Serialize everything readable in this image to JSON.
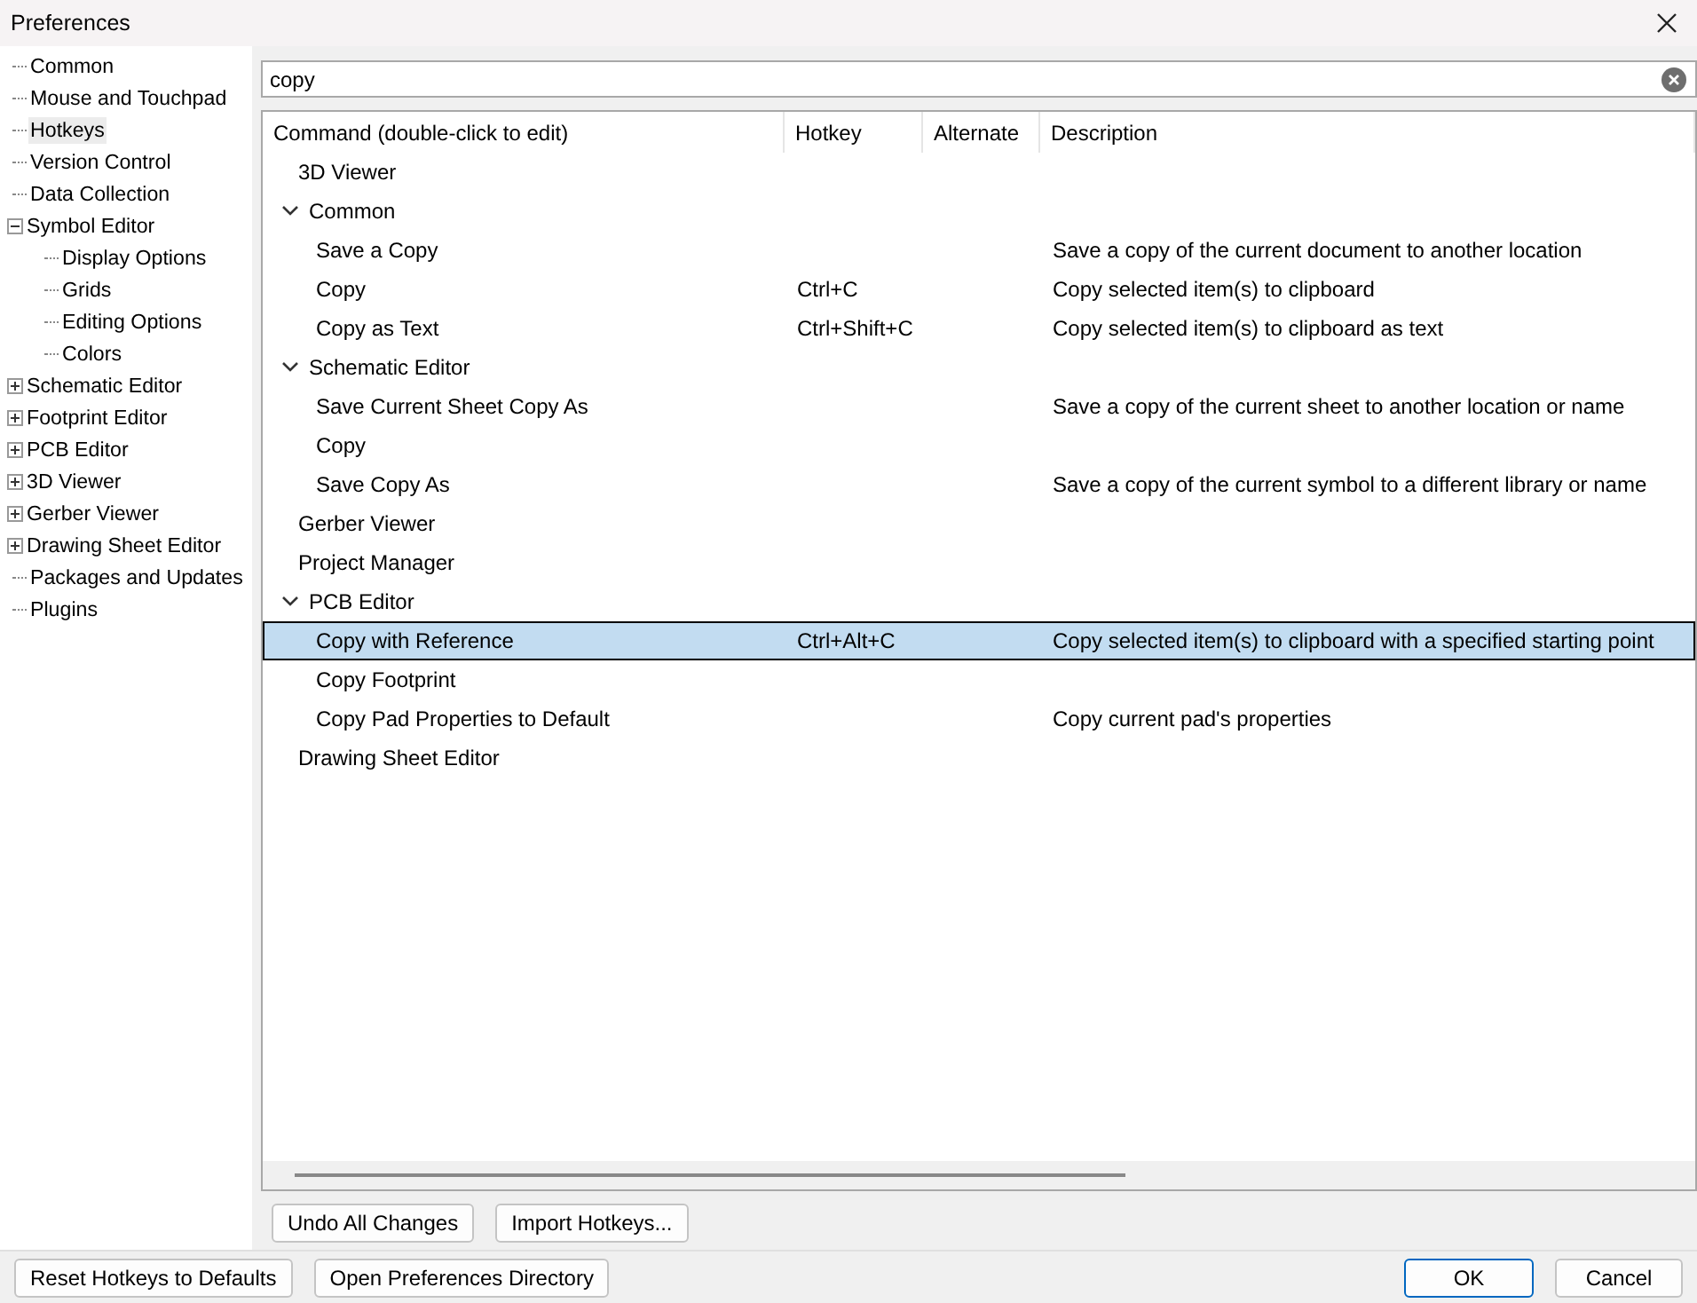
{
  "window": {
    "title": "Preferences"
  },
  "sidebar": {
    "items": [
      {
        "label": "Common",
        "selected": false
      },
      {
        "label": "Mouse and Touchpad",
        "selected": false
      },
      {
        "label": "Hotkeys",
        "selected": true
      },
      {
        "label": "Version Control",
        "selected": false
      },
      {
        "label": "Data Collection",
        "selected": false
      },
      {
        "label": "Symbol Editor",
        "selected": false,
        "expanded": true,
        "children": [
          {
            "label": "Display Options",
            "selected": false
          },
          {
            "label": "Grids",
            "selected": false
          },
          {
            "label": "Editing Options",
            "selected": false
          },
          {
            "label": "Colors",
            "selected": false
          }
        ]
      },
      {
        "label": "Schematic Editor",
        "selected": false,
        "expanded": false
      },
      {
        "label": "Footprint Editor",
        "selected": false,
        "expanded": false
      },
      {
        "label": "PCB Editor",
        "selected": false,
        "expanded": false
      },
      {
        "label": "3D Viewer",
        "selected": false,
        "expanded": false
      },
      {
        "label": "Gerber Viewer",
        "selected": false,
        "expanded": false
      },
      {
        "label": "Drawing Sheet Editor",
        "selected": false,
        "expanded": false
      },
      {
        "label": "Packages and Updates",
        "selected": false
      },
      {
        "label": "Plugins",
        "selected": false
      }
    ]
  },
  "search": {
    "value": "copy"
  },
  "table": {
    "columns": [
      "Command (double-click to edit)",
      "Hotkey",
      "Alternate",
      "Description"
    ],
    "rows": [
      {
        "command": "3D Viewer",
        "selected": false
      },
      {
        "command": "Common",
        "selected": false,
        "expanded": true,
        "children": [
          {
            "command": "Save a Copy",
            "description": "Save a copy of the current document to another location",
            "selected": false
          },
          {
            "command": "Copy",
            "hotkey": "Ctrl+C",
            "description": "Copy selected item(s) to clipboard",
            "selected": false
          },
          {
            "command": "Copy as Text",
            "hotkey": "Ctrl+Shift+C",
            "description": "Copy selected item(s) to clipboard as text",
            "selected": false
          }
        ]
      },
      {
        "command": "Schematic Editor",
        "selected": false,
        "expanded": true,
        "children": [
          {
            "command": "Save Current Sheet Copy As",
            "description": "Save a copy of the current sheet to another location or name",
            "selected": false
          },
          {
            "command": "Copy",
            "selected": false
          },
          {
            "command": "Save Copy As",
            "description": "Save a copy of the current symbol to a different library or name",
            "selected": false
          }
        ]
      },
      {
        "command": "Gerber Viewer",
        "selected": false
      },
      {
        "command": "Project Manager",
        "selected": false
      },
      {
        "command": "PCB Editor",
        "selected": false,
        "expanded": true,
        "children": [
          {
            "command": "Copy with Reference",
            "hotkey": "Ctrl+Alt+C",
            "description": "Copy selected item(s) to clipboard with a specified starting point",
            "selected": true
          },
          {
            "command": "Copy Footprint",
            "selected": false
          },
          {
            "command": "Copy Pad Properties to Default",
            "description": "Copy current pad's properties",
            "selected": false
          }
        ]
      },
      {
        "command": "Drawing Sheet Editor",
        "selected": false
      }
    ]
  },
  "panel_buttons": [
    "Undo All Changes",
    "Import Hotkeys..."
  ],
  "footer": {
    "left_buttons": [
      "Reset Hotkeys to Defaults",
      "Open Preferences Directory"
    ],
    "right_buttons": [
      {
        "label": "OK",
        "kind": "default"
      },
      {
        "label": "Cancel",
        "kind": "normal"
      }
    ]
  }
}
